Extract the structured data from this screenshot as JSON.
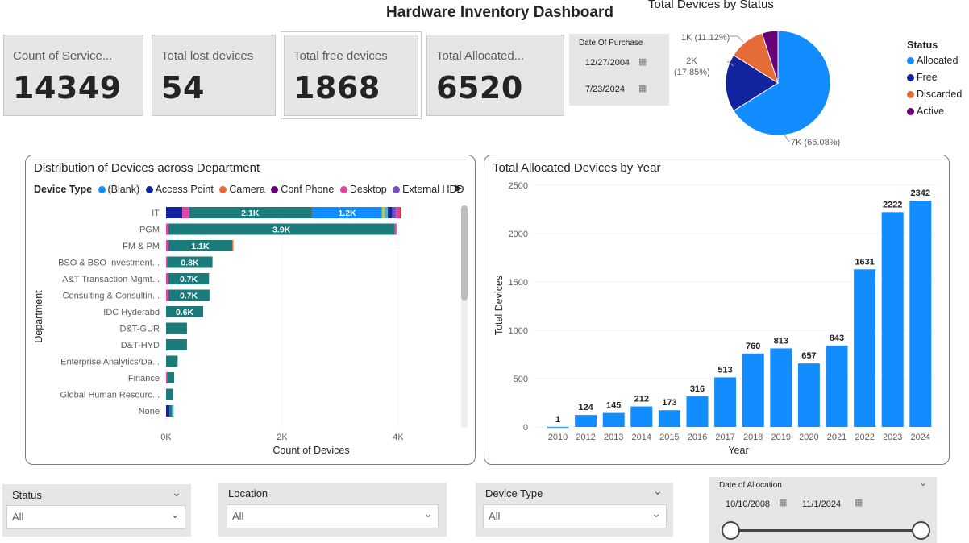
{
  "title": "Hardware Inventory Dashboard",
  "kpis": [
    {
      "label": "Count of Service...",
      "value": "14349"
    },
    {
      "label": "Total lost devices",
      "value": "54"
    },
    {
      "label": "Total free devices",
      "value": "1868"
    },
    {
      "label": "Total Allocated...",
      "value": "6520"
    }
  ],
  "purchase_filter": {
    "label": "Date Of Purchase",
    "start": "12/27/2004",
    "end": "7/23/2024"
  },
  "status_pie": {
    "title": "Total Devices by Status",
    "legend_title": "Status",
    "slices": [
      {
        "name": "Allocated",
        "label": "7K (66.08%)",
        "percent": 66.08,
        "color": "#118dff"
      },
      {
        "name": "Free",
        "label": "2K (17.85%)",
        "percent": 17.85,
        "color": "#12239e"
      },
      {
        "name": "Discarded",
        "label": "1K (11.12%)",
        "percent": 11.12,
        "color": "#e66c37"
      },
      {
        "name": "Active",
        "label": "",
        "percent": 4.95,
        "color": "#6b007b"
      }
    ]
  },
  "dept_chart": {
    "title": "Distribution of Devices across Department",
    "legend_title": "Device Type",
    "legend_items": [
      {
        "name": "(Blank)",
        "color": "#118dff"
      },
      {
        "name": "Access Point",
        "color": "#12239e"
      },
      {
        "name": "Camera",
        "color": "#e66c37"
      },
      {
        "name": "Conf Phone",
        "color": "#6b007b"
      },
      {
        "name": "Desktop",
        "color": "#e044a7"
      },
      {
        "name": "External HDD",
        "color": "#744ec2"
      }
    ],
    "xlabel": "Count of Devices",
    "ylabel": "Department",
    "xticks": [
      "0K",
      "2K",
      "4K"
    ]
  },
  "year_chart": {
    "title": "Total Allocated Devices by Year",
    "xlabel": "Year",
    "ylabel": "Total Devices",
    "yticks": [
      "0",
      "500",
      "1000",
      "1500",
      "2000",
      "2500"
    ]
  },
  "chart_data": [
    {
      "type": "bar",
      "orientation": "horizontal",
      "stacked": true,
      "title": "Distribution of Devices across Department",
      "xlabel": "Count of Devices",
      "ylabel": "Department",
      "xlim": [
        0,
        4000
      ],
      "categories": [
        "IT",
        "PGM",
        "FM & PM",
        "BSO & BSO Investment...",
        "A&T Transaction Mgmt...",
        "Consulting & Consultin...",
        "IDC Hyderabd",
        "D&T-GUR",
        "D&T-HYD",
        "Enterprise Analytics/Da...",
        "Finance",
        "Global Human Resourc...",
        "None"
      ],
      "segments": [
        [
          {
            "color": "#12239e",
            "value": 280,
            "label": ""
          },
          {
            "color": "#e044a7",
            "value": 120,
            "label": ""
          },
          {
            "color": "#1b7a7a",
            "value": 2100,
            "label": "2.1K"
          },
          {
            "color": "#5a6e6e",
            "value": 20,
            "label": ""
          },
          {
            "color": "#118dff",
            "value": 1200,
            "label": "1.2K"
          },
          {
            "color": "#b0d040",
            "value": 40,
            "label": ""
          },
          {
            "color": "#5ab0c8",
            "value": 60,
            "label": ""
          },
          {
            "color": "#12239e",
            "value": 80,
            "label": ""
          },
          {
            "color": "#744ec2",
            "value": 60,
            "label": ""
          },
          {
            "color": "#e044a7",
            "value": 60,
            "label": ""
          },
          {
            "color": "#c83c3c",
            "value": 30,
            "label": ""
          }
        ],
        [
          {
            "color": "#e044a7",
            "value": 40,
            "label": ""
          },
          {
            "color": "#1b7a7a",
            "value": 3900,
            "label": "3.9K"
          },
          {
            "color": "#e044a7",
            "value": 30,
            "label": ""
          }
        ],
        [
          {
            "color": "#e044a7",
            "value": 40,
            "label": ""
          },
          {
            "color": "#1b7a7a",
            "value": 1100,
            "label": "1.1K"
          },
          {
            "color": "#e66c37",
            "value": 20,
            "label": ""
          }
        ],
        [
          {
            "color": "#e044a7",
            "value": 20,
            "label": ""
          },
          {
            "color": "#1b7a7a",
            "value": 780,
            "label": "0.8K"
          }
        ],
        [
          {
            "color": "#e044a7",
            "value": 40,
            "label": ""
          },
          {
            "color": "#1b7a7a",
            "value": 700,
            "label": "0.7K"
          }
        ],
        [
          {
            "color": "#e044a7",
            "value": 40,
            "label": ""
          },
          {
            "color": "#1b7a7a",
            "value": 700,
            "label": "0.7K"
          },
          {
            "color": "#5a6e6e",
            "value": 20,
            "label": ""
          }
        ],
        [
          {
            "color": "#1b7a7a",
            "value": 640,
            "label": "0.6K"
          }
        ],
        [
          {
            "color": "#1b7a7a",
            "value": 360,
            "label": ""
          }
        ],
        [
          {
            "color": "#1b7a7a",
            "value": 360,
            "label": ""
          }
        ],
        [
          {
            "color": "#1b7a7a",
            "value": 200,
            "label": ""
          }
        ],
        [
          {
            "color": "#e044a7",
            "value": 20,
            "label": ""
          },
          {
            "color": "#1b7a7a",
            "value": 120,
            "label": ""
          }
        ],
        [
          {
            "color": "#1b7a7a",
            "value": 120,
            "label": ""
          }
        ],
        [
          {
            "color": "#12239e",
            "value": 60,
            "label": ""
          },
          {
            "color": "#1b7a7a",
            "value": 40,
            "label": ""
          },
          {
            "color": "#5ab0c8",
            "value": 30,
            "label": ""
          }
        ]
      ]
    },
    {
      "type": "bar",
      "title": "Total Allocated Devices by Year",
      "xlabel": "Year",
      "ylabel": "Total Devices",
      "ylim": [
        0,
        2500
      ],
      "categories": [
        "2010",
        "2012",
        "2013",
        "2014",
        "2015",
        "2016",
        "2017",
        "2018",
        "2019",
        "2020",
        "2021",
        "2022",
        "2023",
        "2024"
      ],
      "values": [
        1,
        124,
        145,
        212,
        173,
        316,
        513,
        760,
        813,
        657,
        843,
        1631,
        2222,
        2342
      ],
      "color": "#118dff"
    }
  ],
  "filters": [
    {
      "label": "Status",
      "value": "All"
    },
    {
      "label": "Location",
      "value": "All"
    },
    {
      "label": "Device Type",
      "value": "All"
    }
  ],
  "allocation_filter": {
    "label": "Date of Allocation",
    "start": "10/10/2008",
    "end": "11/1/2024"
  }
}
